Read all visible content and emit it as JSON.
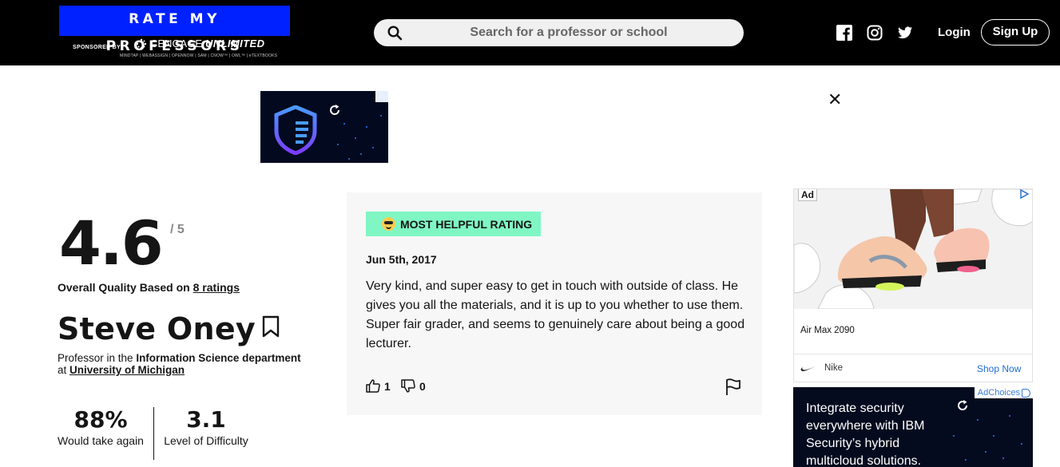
{
  "header": {
    "logo_text": "RATE MY PROFESSORS",
    "sponsored_by": "SPONSORED BY:",
    "cengage": "CENGAGE",
    "cengage_unlimited": "UNLIMITED",
    "cengage_products": "MINDTAP | WEBASSIGN | OPENNOW | SAM | CNOW™ | OWL™ | eTEXTBOOKS",
    "search_placeholder": "Search for a professor or school",
    "login": "Login",
    "signup": "Sign Up"
  },
  "professor": {
    "rating": "4.6",
    "rating_out_of": "/ 5",
    "overall_prefix": "Overall Quality Based on",
    "ratings_count_link": "8 ratings",
    "name": "Steve Oney",
    "dept_prefix": "Professor in the",
    "department": "Information Science department",
    "at": "at",
    "school": "University of Michigan",
    "would_take_again": "88%",
    "would_take_again_label": "Would take again",
    "difficulty": "3.1",
    "difficulty_label": "Level of Difficulty"
  },
  "review": {
    "badge": "MOST HELPFUL RATING",
    "date": "Jun 5th, 2017",
    "text": "Very kind, and super easy to get in touch with outside of class. He gives you all the materials, and it is up to you whether to use them. Super fair grader, and seems to genuinely care about being a good lecturer.",
    "thumbs_up": "1",
    "thumbs_down": "0"
  },
  "ads": {
    "nike_tag": "Ad",
    "nike_product": "Air Max 2090",
    "nike_brand": "Nike",
    "nike_cta": "Shop Now",
    "adchoices": "AdChoices",
    "ibm_text": "Integrate security everywhere with IBM Security’s hybrid multicloud solutions."
  }
}
